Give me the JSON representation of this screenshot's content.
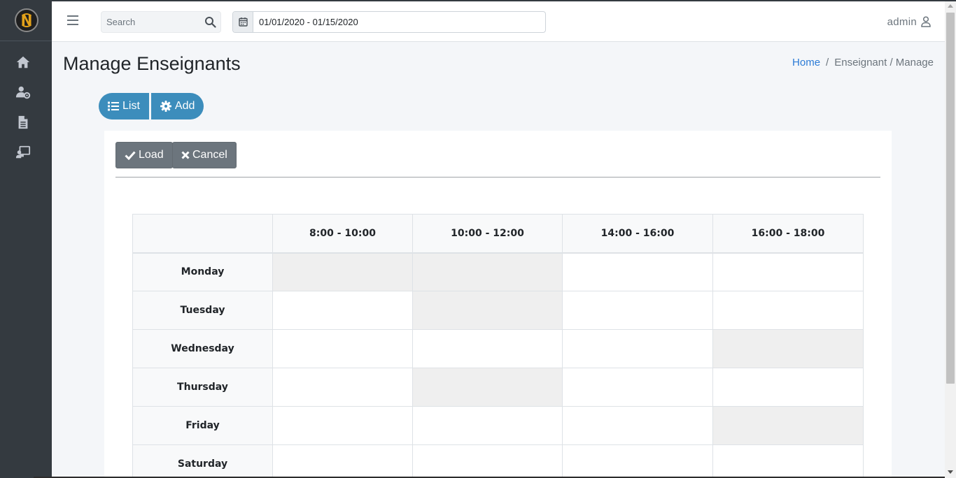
{
  "navbar": {
    "search_placeholder": "Search",
    "date_range": "01/01/2020 - 01/15/2020",
    "user_name": "admin"
  },
  "sidebar": {
    "items": [
      {
        "icon": "home-icon"
      },
      {
        "icon": "user-gear-icon"
      },
      {
        "icon": "document-icon"
      },
      {
        "icon": "teacher-board-icon"
      }
    ]
  },
  "page": {
    "title": "Manage Enseignants",
    "breadcrumb_home": "Home",
    "breadcrumb_sep": "/",
    "breadcrumb_current": "Enseignant / Manage"
  },
  "pills": {
    "list_label": "List",
    "add_label": "Add"
  },
  "actions": {
    "load_label": "Load",
    "cancel_label": "Cancel"
  },
  "schedule": {
    "time_slots": [
      "8:00 - 10:00",
      "10:00 - 12:00",
      "14:00 - 16:00",
      "16:00 - 18:00"
    ],
    "days": [
      "Monday",
      "Tuesday",
      "Wednesday",
      "Thursday",
      "Friday",
      "Saturday"
    ],
    "busy": [
      [
        true,
        true,
        false,
        false
      ],
      [
        false,
        true,
        false,
        false
      ],
      [
        false,
        false,
        false,
        true
      ],
      [
        false,
        true,
        false,
        false
      ],
      [
        false,
        false,
        false,
        true
      ],
      [
        false,
        false,
        false,
        false
      ]
    ]
  },
  "colors": {
    "sidebar_bg": "#343a40",
    "accent": "#3c8dbc",
    "button_secondary": "#6c757d",
    "busy_cell": "#efefef"
  }
}
